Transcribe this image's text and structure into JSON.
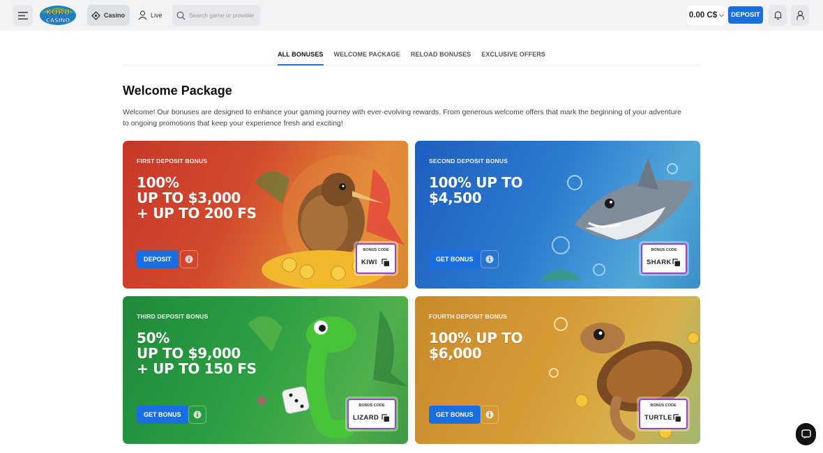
{
  "header": {
    "nav_casino": "Casino",
    "nav_live": "Live",
    "search_placeholder": "Search game or provider",
    "balance": "0.00 C$",
    "deposit_label": "DEPOSIT",
    "logo_text": "KORU CASINO"
  },
  "tabs": [
    {
      "label": "ALL BONUSES",
      "active": true
    },
    {
      "label": "WELCOME PACKAGE",
      "active": false
    },
    {
      "label": "RELOAD BONUSES",
      "active": false
    },
    {
      "label": "EXCLUSIVE OFFERS",
      "active": false
    }
  ],
  "main": {
    "title": "Welcome Package",
    "intro": "Welcome! Our bonuses are designed to enhance your gaming journey with ever-evolving rewards. From generous welcome offers that mark the beginning of your adventure to ongoing promotions that keep your experience fresh and exciting!"
  },
  "cards": [
    {
      "kicker": "FIRST DEPOSIT BONUS",
      "line1": "100%",
      "line2": "UP TO $3,000",
      "line3": "+ UP TO 200 FS",
      "cta": "DEPOSIT",
      "code_label": "BONUS CODE",
      "code": "KIWI",
      "color": "#c8372a",
      "art_icon": "kiwi-bird-icon"
    },
    {
      "kicker": "SECOND DEPOSIT BONUS",
      "line1": "100% UP TO",
      "line2": "$4,500",
      "line3": "",
      "cta": "GET BONUS",
      "code_label": "BONUS CODE",
      "code": "SHARK",
      "color": "#1d5fbf",
      "art_icon": "shark-icon"
    },
    {
      "kicker": "THIRD DEPOSIT BONUS",
      "line1": "50%",
      "line2": "UP TO $9,000",
      "line3": "+ UP TO 150 FS",
      "cta": "GET BONUS",
      "code_label": "BONUS CODE",
      "code": "LIZARD",
      "color": "#1f8a3a",
      "art_icon": "lizard-icon"
    },
    {
      "kicker": "FOURTH DEPOSIT BONUS",
      "line1": "100% UP TO",
      "line2": "$6,000",
      "line3": "",
      "cta": "GET BONUS",
      "code_label": "BONUS CODE",
      "code": "TURTLE",
      "color": "#c98a2a",
      "art_icon": "turtle-icon"
    }
  ],
  "colors": {
    "accent": "#1a6fe0",
    "code_border": "#9b3fd1"
  }
}
